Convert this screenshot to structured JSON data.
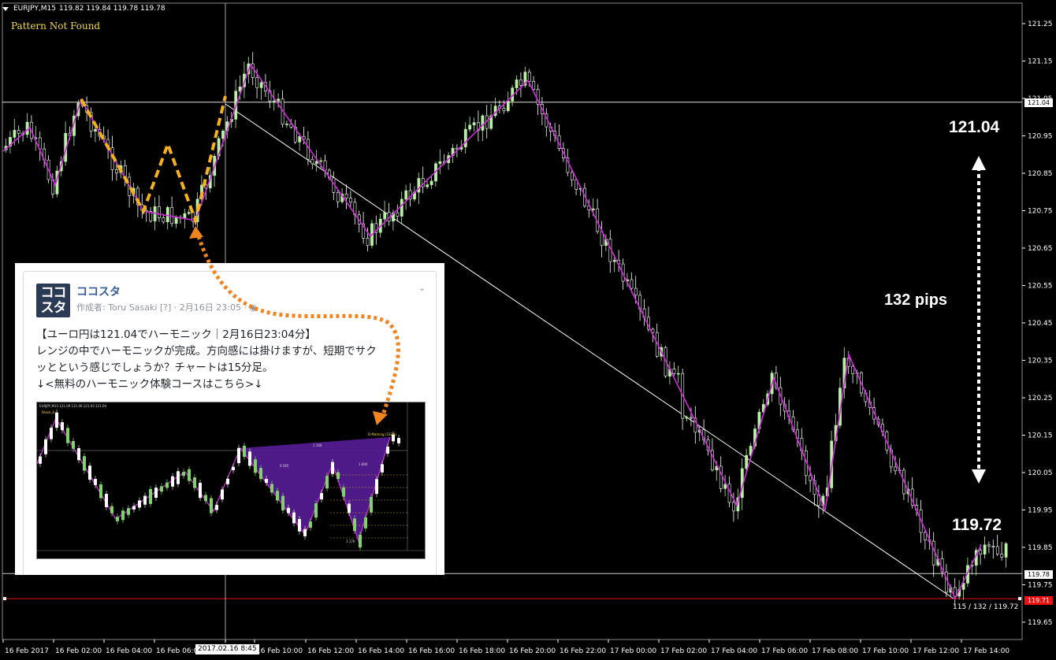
{
  "chart_header": {
    "symbol": "EURJPY,M15",
    "ohlc": "119.82 119.84 119.78 119.78"
  },
  "indicator_status": "Pattern Not Found",
  "price_axis": {
    "labels": [
      "121.25",
      "121.15",
      "121.05",
      "120.95",
      "120.85",
      "120.75",
      "120.65",
      "120.55",
      "120.45",
      "120.35",
      "120.25",
      "120.15",
      "120.05",
      "119.95",
      "119.85",
      "119.75",
      "119.65"
    ],
    "current_price_tag": "119.78",
    "top_line_tag": "121.04",
    "low_line_tag": "119.71"
  },
  "time_axis": {
    "labels": [
      "16 Feb 2017",
      "16 Feb 02:00",
      "16 Feb 04:00",
      "16 Feb 06:00",
      "2017.02.16 8:45",
      "16 Feb 10:00",
      "16 Feb 12:00",
      "16 Feb 14:00",
      "16 Feb 16:00",
      "16 Feb 18:00",
      "16 Feb 20:00",
      "16 Feb 22:00",
      "17 Feb 00:00",
      "17 Feb 02:00",
      "17 Feb 04:00",
      "17 Feb 06:00",
      "17 Feb 08:00",
      "17 Feb 10:00",
      "17 Feb 12:00",
      "17 Feb 14:00"
    ]
  },
  "annotations": {
    "high_price": "121.04",
    "range_pips": "132 pips",
    "low_price": "119.72",
    "bottom_note": "115 / 132 / 119.72"
  },
  "colors": {
    "bull": "#b8f0a4",
    "bear": "#ffffff",
    "zigzag": "#d02adb",
    "pattern": "#f5b120",
    "arrow": "#f0841e",
    "low_line": "#e01010"
  },
  "post": {
    "page_name": "ココスタ",
    "logo_text": [
      "ココ",
      "スタ"
    ],
    "meta": "作成者: Toru Sasaki [?] · 2月16日 23:05 · ",
    "lines": [
      "【ユーロ円は121.04でハーモニック｜2月16日23:04分】",
      "レンジの中でハーモニックが完成。方向感には掛けますが、短期でサク",
      "ッとという感じでしょうか？チャートは15分足。",
      "↓<無料のハーモニック体験コースはこちら>↓"
    ],
    "thumbnail": {
      "header": "EURJPY,M15  121.09 121.06 121.03 121.04",
      "pattern_name": "Shark_6",
      "label_d": "D-Marking (332%)",
      "ratio_a": "0.565",
      "ratio_b": "1.100",
      "ratio_c": "1.800",
      "ratio_d": "1.176"
    }
  }
}
